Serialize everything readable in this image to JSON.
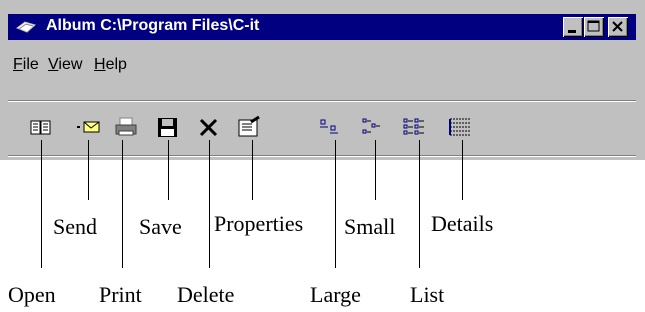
{
  "window": {
    "title": "Album C:\\Program Files\\C-it",
    "icon": "album-icon"
  },
  "titlebar_buttons": [
    "minimize-icon",
    "maximize-icon",
    "close-icon"
  ],
  "menu": [
    {
      "label_rest": "ile",
      "accel": "F"
    },
    {
      "label_rest": "iew",
      "accel": "V"
    },
    {
      "label_rest": "elp",
      "accel": "H"
    }
  ],
  "toolbar": [
    {
      "icon": "open-book-icon",
      "label": "Open"
    },
    {
      "icon": "send-envelope-icon",
      "label": "Send"
    },
    {
      "icon": "print-icon",
      "label": "Print"
    },
    {
      "icon": "save-floppy-icon",
      "label": "Save"
    },
    {
      "icon": "delete-x-icon",
      "label": "Delete"
    },
    {
      "icon": "properties-icon",
      "label": "Properties"
    },
    {
      "icon": "large-icons-view-icon",
      "label": "Large"
    },
    {
      "icon": "small-icons-view-icon",
      "label": "Small"
    },
    {
      "icon": "list-view-icon",
      "label": "List"
    },
    {
      "icon": "details-view-icon",
      "label": "Details"
    }
  ]
}
